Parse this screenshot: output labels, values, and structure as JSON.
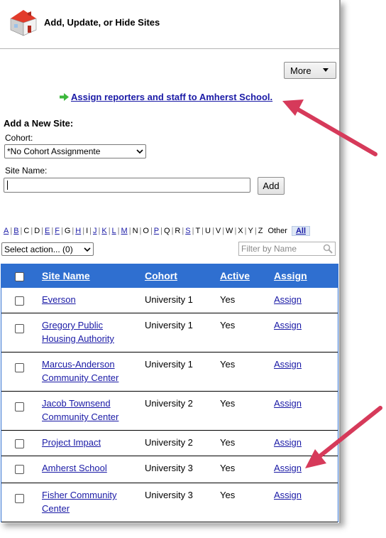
{
  "header": {
    "title": "Add, Update, or Hide Sites",
    "logo_icon": "house-icon"
  },
  "toolbar": {
    "more_label": "More"
  },
  "assign_link": {
    "text": "Assign reporters and staff to Amherst School.",
    "icon": "green-arrow-icon"
  },
  "add_site": {
    "title": "Add a New Site:",
    "cohort_label": "Cohort:",
    "cohort_value": "*No Cohort Assignmente",
    "site_name_label": "Site Name:",
    "site_name_value": "",
    "add_label": "Add"
  },
  "alphabet": [
    "A",
    "B",
    "C",
    "D",
    "E",
    "F",
    "G",
    "H",
    "I",
    "J",
    "K",
    "L",
    "M",
    "N",
    "O",
    "P",
    "Q",
    "R",
    "S",
    "T",
    "U",
    "V",
    "W",
    "X",
    "Y",
    "Z"
  ],
  "alphabet_links": [
    "A",
    "B",
    "E",
    "F",
    "H",
    "J",
    "K",
    "L",
    "M",
    "P",
    "S"
  ],
  "alphabet_other": "Other",
  "alphabet_all": "All",
  "action_select": {
    "value": "Select action... (0)"
  },
  "filter": {
    "placeholder": "Filter by Name"
  },
  "table": {
    "columns": [
      "Site Name",
      "Cohort",
      "Active",
      "Assign"
    ],
    "rows": [
      {
        "name": "Everson",
        "cohort": "University 1",
        "active": "Yes",
        "assign": "Assign"
      },
      {
        "name": "Gregory Public Housing Authority",
        "cohort": "University 1",
        "active": "Yes",
        "assign": "Assign"
      },
      {
        "name": "Marcus-Anderson Community Center",
        "cohort": "University 1",
        "active": "Yes",
        "assign": "Assign"
      },
      {
        "name": "Jacob Townsend Community Center",
        "cohort": "University 2",
        "active": "Yes",
        "assign": "Assign"
      },
      {
        "name": "Project Impact",
        "cohort": "University 2",
        "active": "Yes",
        "assign": "Assign"
      },
      {
        "name": "Amherst School",
        "cohort": "University 3",
        "active": "Yes",
        "assign": "Assign"
      },
      {
        "name": "Fisher Community Center",
        "cohort": "University 3",
        "active": "Yes",
        "assign": "Assign"
      }
    ]
  },
  "colors": {
    "header_blue": "#2f6fd0",
    "link": "#1a1aa6",
    "callout": "#d63a5a",
    "arrow_green": "#3cb83c"
  }
}
